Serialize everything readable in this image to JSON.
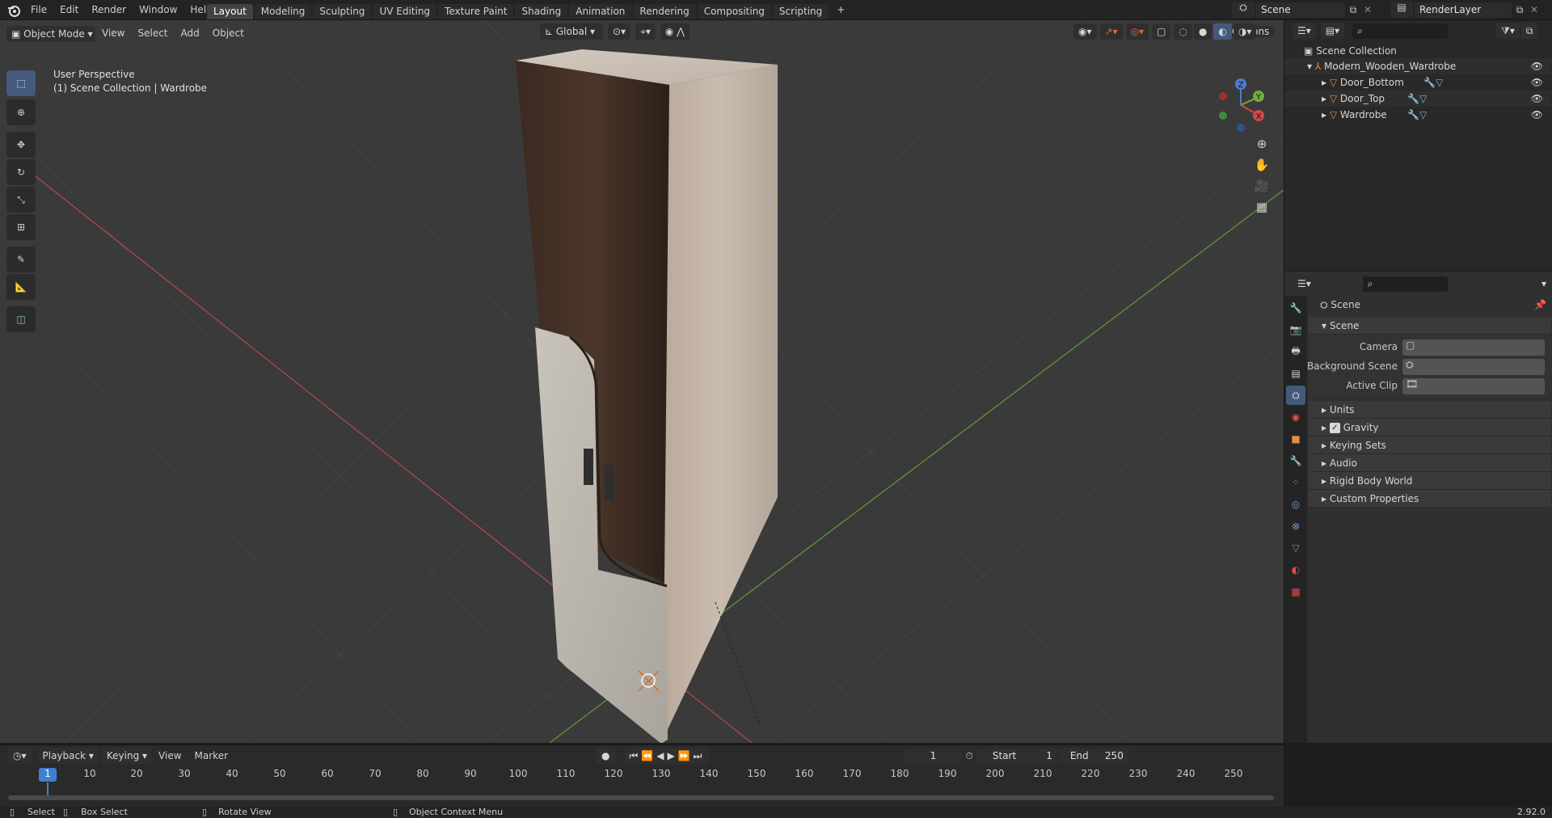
{
  "topbar": {
    "menus": [
      "File",
      "Edit",
      "Render",
      "Window",
      "Help"
    ],
    "workspaces": [
      "Layout",
      "Modeling",
      "Sculpting",
      "UV Editing",
      "Texture Paint",
      "Shading",
      "Animation",
      "Rendering",
      "Compositing",
      "Scripting"
    ],
    "active_workspace": "Layout",
    "add_tab": "+",
    "scene_name": "Scene",
    "view_layer": "RenderLayer"
  },
  "viewport_header": {
    "mode": "Object Mode",
    "menus": [
      "View",
      "Select",
      "Add",
      "Object"
    ],
    "orientation": "Global",
    "options": "Options"
  },
  "viewport": {
    "perspective_label": "User Perspective",
    "collection_label": "(1) Scene Collection | Wardrobe",
    "gizmo_axes": [
      "Z",
      "Y",
      "X"
    ],
    "colors": {
      "background": "#3a3a3a",
      "grid": "#454545",
      "x_axis": "#b34a4a",
      "y_axis": "#5f9e3b",
      "active_tool": "#445a7d"
    }
  },
  "toolbar": {
    "tools": [
      "select-box-tool",
      "cursor-tool",
      "move-tool",
      "rotate-tool",
      "scale-tool",
      "transform-tool",
      "annotate-tool",
      "measure-tool",
      "add-cube-tool"
    ]
  },
  "outliner": {
    "root": "Scene Collection",
    "collection": "Modern_Wooden_Wardrobe",
    "objects": [
      "Door_Bottom",
      "Door_Top",
      "Wardrobe"
    ]
  },
  "properties": {
    "context_title": "Scene",
    "section": "Scene",
    "fields": [
      {
        "label": "Camera"
      },
      {
        "label": "Background Scene"
      },
      {
        "label": "Active Clip"
      }
    ],
    "panels": [
      "Units",
      "Gravity",
      "Keying Sets",
      "Audio",
      "Rigid Body World",
      "Custom Properties"
    ],
    "gravity_checked": true
  },
  "timeline": {
    "menus": [
      "Playback",
      "Keying",
      "View",
      "Marker"
    ],
    "current_frame": "1",
    "start_label": "Start",
    "start": "1",
    "end_label": "End",
    "end": "250",
    "ruler": [
      "1",
      "10",
      "20",
      "30",
      "40",
      "50",
      "60",
      "70",
      "80",
      "90",
      "100",
      "110",
      "120",
      "130",
      "140",
      "150",
      "160",
      "170",
      "180",
      "190",
      "200",
      "210",
      "220",
      "230",
      "240",
      "250"
    ]
  },
  "statusbar": {
    "select": "Select",
    "box_select": "Box Select",
    "rotate_view": "Rotate View",
    "context_menu": "Object Context Menu",
    "version": "2.92.0"
  }
}
